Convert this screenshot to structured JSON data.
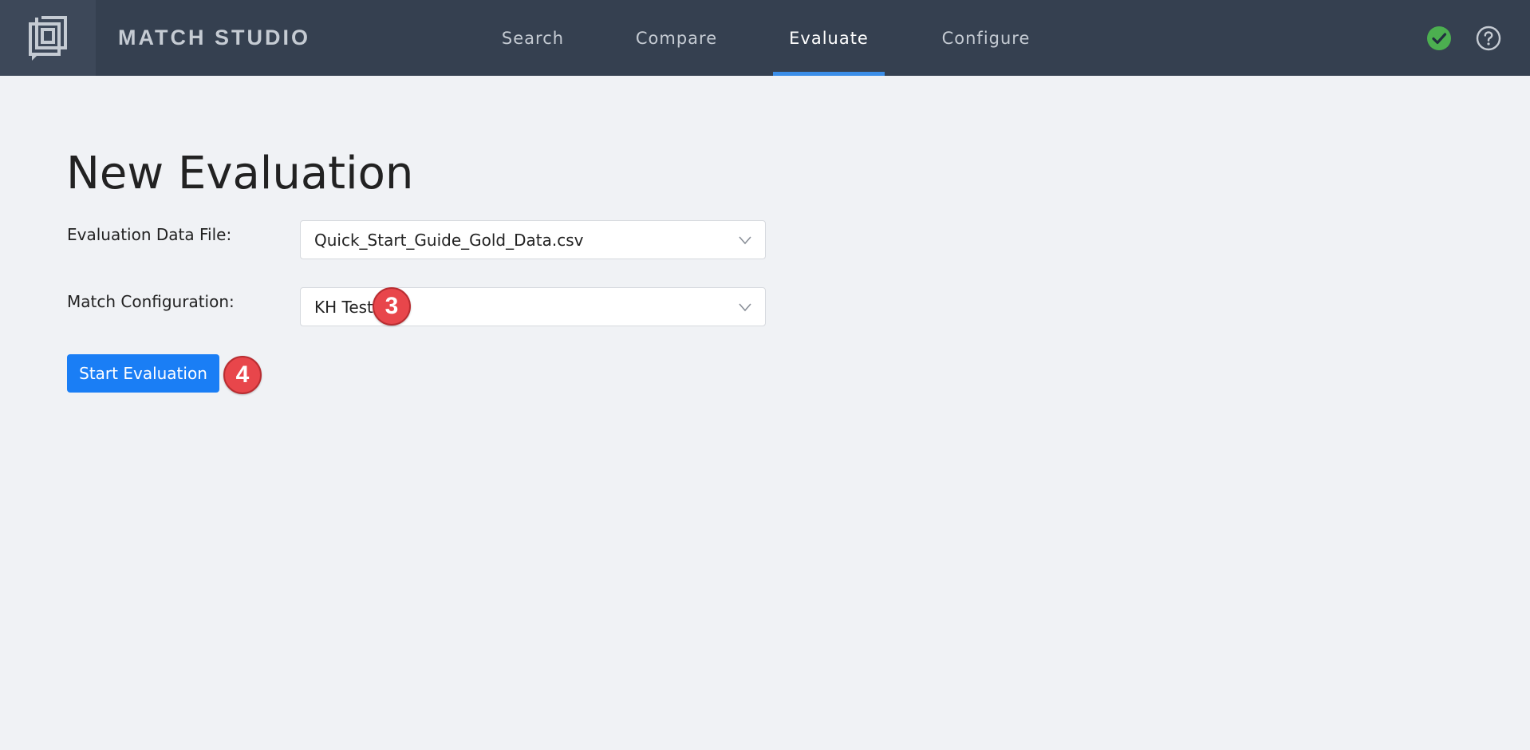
{
  "app": {
    "brand": "MATCH STUDIO",
    "logo_icon": "bracket-logo-icon"
  },
  "nav": {
    "tabs": [
      {
        "label": "Search",
        "active": false
      },
      {
        "label": "Compare",
        "active": false
      },
      {
        "label": "Evaluate",
        "active": true
      },
      {
        "label": "Configure",
        "active": false
      }
    ],
    "status_icon": "check-circle-icon",
    "help_icon": "question-circle-icon"
  },
  "page": {
    "title": "New Evaluation"
  },
  "form": {
    "data_file": {
      "label": "Evaluation Data File:",
      "value": "Quick_Start_Guide_Gold_Data.csv"
    },
    "match_config": {
      "label": "Match Configuration:",
      "value": "KH Test"
    },
    "start_button": "Start Evaluation"
  },
  "annotations": {
    "badge_config": "3",
    "badge_start": "4"
  },
  "colors": {
    "topbar": "#354050",
    "accent": "#3b8ee8",
    "primary_button": "#1a7ef5",
    "status_ok": "#4caf50",
    "badge": "#e8464b"
  }
}
